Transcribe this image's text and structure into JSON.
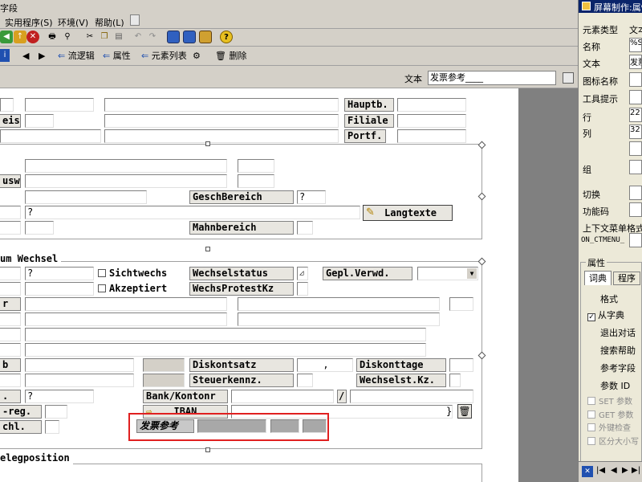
{
  "menubar": {
    "partial_title": "字段",
    "items": [
      "实用程序(S)",
      "环境(V)",
      "帮助(L)"
    ]
  },
  "toolbar2": {
    "flow_logic": "流逻辑",
    "attributes": "属性",
    "element_list": "元素列表",
    "delete": "删除"
  },
  "textbar": {
    "label": "文本",
    "value": "发票参考____"
  },
  "screen": {
    "header": {
      "hauptb": "Hauptb.",
      "filiale": "Filiale",
      "portf": "Portf.",
      "left_partial": "eis"
    },
    "mid": {
      "usw_partial": "usw",
      "geschbereich": "GeschBereich",
      "q1": "?",
      "q2": "?",
      "langtexte": "Langtexte",
      "mahnbereich": "Mahnbereich"
    },
    "wechsel": {
      "frame_title": "um Wechsel",
      "q": "?",
      "sichtwechs": "Sichtwechs",
      "akzeptiert": "Akzeptiert",
      "wechselstatus": "Wechselstatus",
      "wechsprotestkz": "WechsProtestKz",
      "gepl_verwd": "Gepl.Verwd.",
      "r_partial": "r",
      "b_partial": "b",
      "diskontsatz": "Diskontsatz",
      "diskontsatz_val": ",",
      "diskonttage": "Diskonttage",
      "steuerkennz": "Steuerkennz.",
      "wechselst_kz": "Wechselst.Kz.",
      "dot_partial": ".",
      "q3": "?",
      "bank_kontonr": "Bank/Kontonr",
      "slash": "/",
      "reg_partial": "-reg.",
      "iban": "IBAN",
      "chl_partial": "chl.",
      "brace": "}",
      "invoice_ref": "发票参考"
    },
    "bottom_frame_title": "elegposition"
  },
  "right_panel": {
    "title": "屏幕制作:属性",
    "rows": {
      "element_type": "元素类型",
      "element_type_val": "文本",
      "name": "名称",
      "name_val": "%SE",
      "text": "文本",
      "text_val": "发票",
      "icon_name": "图标名称",
      "tooltip": "工具提示",
      "row": "行",
      "row_val": "22",
      "col": "列",
      "col_val": "32",
      "group": "组",
      "toggle": "切换",
      "func_code": "功能码",
      "context_menu": "上下文菜单格式",
      "context_menu_val": "ON_CTMENU_"
    },
    "attributes_group": "属性",
    "tabs": [
      "词典",
      "程序"
    ],
    "dict_items": {
      "format": "格式",
      "from_dict": "从字典",
      "exit_dialog": "退出对话",
      "search_help": "搜索帮助",
      "ref_field": "参考字段",
      "param_id": "参数 ID",
      "set_param": "SET 参数",
      "get_param": "GET 参数",
      "foreign_key": "外键检查",
      "case_sensitive": "区分大小写"
    }
  },
  "colors": {
    "window_bg": "#d4d0c8",
    "panel_bg": "#ffffff",
    "dark_area": "#808080",
    "highlight_box": "#e02020",
    "title_blue": "#0a246a"
  }
}
